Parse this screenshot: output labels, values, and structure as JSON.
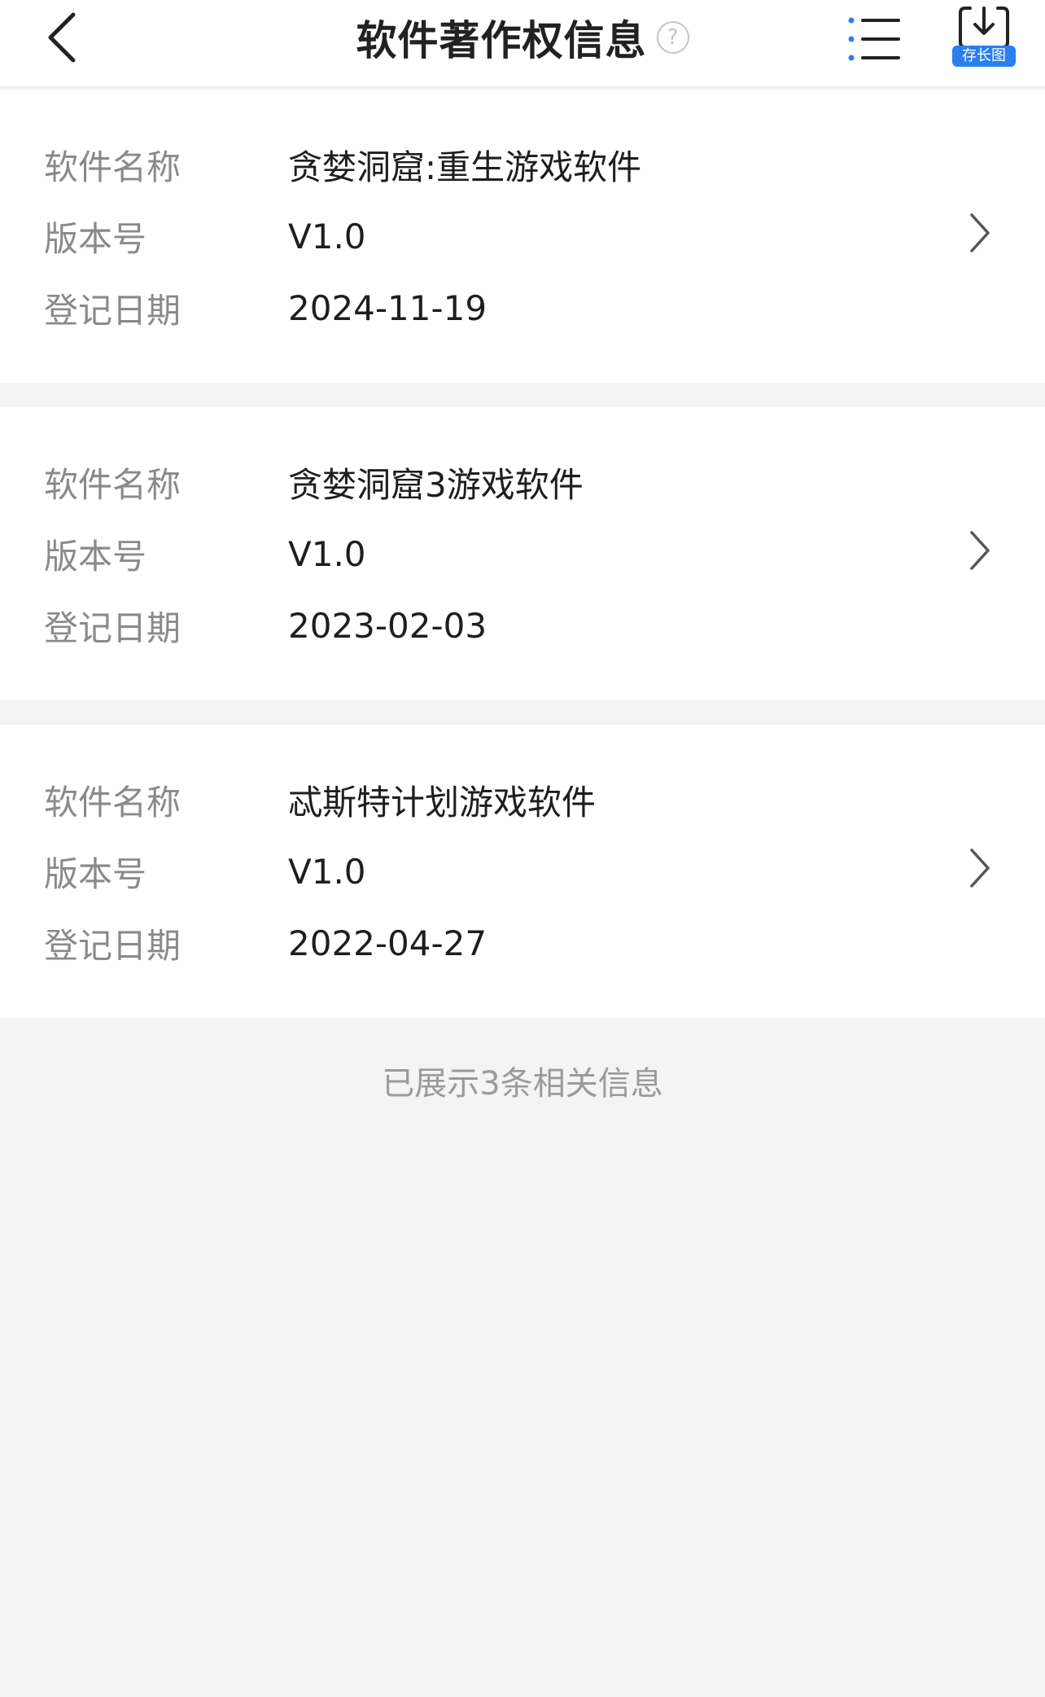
{
  "header": {
    "title": "软件著作权信息",
    "help_icon_glyph": "?",
    "save_label": "存长图",
    "accent_color": "#2a7ef0"
  },
  "icons": {
    "back": "back-chevron-icon",
    "help": "question-circle-icon",
    "menu": "list-menu-icon",
    "save": "download-icon",
    "row_arrow": "chevron-right-icon"
  },
  "records": [
    {
      "name_label": "软件名称",
      "name": "贪婪洞窟:重生游戏软件",
      "version_label": "版本号",
      "version": "V1.0",
      "date_label": "登记日期",
      "date": "2024-11-19"
    },
    {
      "name_label": "软件名称",
      "name": "贪婪洞窟3游戏软件",
      "version_label": "版本号",
      "version": "V1.0",
      "date_label": "登记日期",
      "date": "2023-02-03"
    },
    {
      "name_label": "软件名称",
      "name": "忒斯特计划游戏软件",
      "version_label": "版本号",
      "version": "V1.0",
      "date_label": "登记日期",
      "date": "2022-04-27"
    }
  ],
  "footer": {
    "note": "已展示3条相关信息"
  }
}
